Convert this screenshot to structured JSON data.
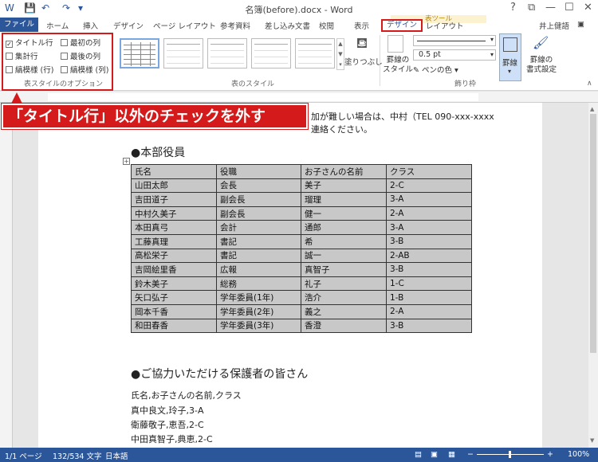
{
  "window": {
    "title": "名簿(before).docx - Word",
    "controls": [
      "?",
      "⧉",
      "—",
      "☐",
      "✕"
    ]
  },
  "tabs": {
    "file": "ファイル",
    "items": [
      "ホーム",
      "挿入",
      "デザイン",
      "ページ レイアウト",
      "参考資料",
      "差し込み文書",
      "校閲",
      "表示"
    ],
    "tools_label": "表ツール",
    "design": "デザイン",
    "layout": "レイアウト",
    "user": "井上健語"
  },
  "ribbon": {
    "options": {
      "header_row": "タイトル行",
      "total_row": "集計行",
      "banded_rows": "縞模様 (行)",
      "first_column": "最初の列",
      "last_column": "最後の列",
      "banded_columns": "縞模様 (列)",
      "group_label": "表スタイルのオプション"
    },
    "styles_label": "表のスタイル",
    "shading": "塗りつぶし",
    "border_styles_1": "罫線の",
    "border_styles_2": "スタイル",
    "pen_weight": "0.5 pt",
    "pen_color": "ペンの色",
    "borders": "罫線",
    "painter_1": "罫線の",
    "painter_2": "書式設定",
    "borders_group_label": "飾り枠"
  },
  "callout": "「タイトル行」以外のチェックを外す",
  "doc": {
    "intro_line1": "加が難しい場合は、中村（TEL 090-xxx-xxxx",
    "intro_line2": "連絡ください。",
    "heading1": "●本部役員",
    "table": {
      "headers": [
        "氏名",
        "役職",
        "お子さんの名前",
        "クラス"
      ],
      "rows": [
        [
          "山田太郎",
          "会長",
          "美子",
          "2-C"
        ],
        [
          "吉田道子",
          "副会長",
          "瑠理",
          "3-A"
        ],
        [
          "中村久美子",
          "副会長",
          "健一",
          "2-A"
        ],
        [
          "本田真弓",
          "会計",
          "通郎",
          "3-A"
        ],
        [
          "工藤真理",
          "書記",
          "希",
          "3-B"
        ],
        [
          "高松栄子",
          "書記",
          "誠一",
          "2-AB"
        ],
        [
          "吉岡絵里香",
          "広報",
          "真智子",
          "3-B"
        ],
        [
          "鈴木美子",
          "総務",
          "礼子",
          "1-C"
        ],
        [
          "矢口弘子",
          "学年委員(1年)",
          "浩介",
          "1-B"
        ],
        [
          "岡本千香",
          "学年委員(2年)",
          "義之",
          "2-A"
        ],
        [
          "和田春香",
          "学年委員(3年)",
          "香澄",
          "3-B"
        ]
      ]
    },
    "heading2": "●ご協力いただける保護者の皆さん",
    "lines": [
      "氏名,お子さんの名前,クラス",
      "真中良文,玲子,3-A",
      "衛藤敬子,恵吾,2-C",
      "中田真智子,典恵,2-C"
    ]
  },
  "status": {
    "page": "1/1 ページ",
    "words": "132/534 文字",
    "lang": "日本語",
    "zoom": "100%"
  },
  "colors": {
    "accent": "#2b579a",
    "highlight": "#d41a1a",
    "table_fill": "#c8c8c8"
  }
}
